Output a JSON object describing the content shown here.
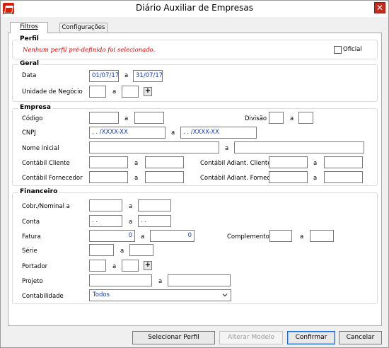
{
  "window": {
    "title": "Diário Auxiliar de Empresas",
    "close_glyph": "✕"
  },
  "tabs": [
    {
      "label": "Filtros",
      "active": true
    },
    {
      "label": "Configurações",
      "active": false
    }
  ],
  "perfil": {
    "title": "Perfil",
    "message": "Nenhum perfil pré-definido foi selecionado.",
    "oficial_label": "Oficial",
    "oficial_checked": false
  },
  "geral": {
    "title": "Geral",
    "data_label": "Data",
    "data_from": "01/07/17",
    "data_to": "31/07/17",
    "a": "a",
    "unidade_label": "Unidade de Negócio",
    "plus": "+"
  },
  "empresa": {
    "title": "Empresa",
    "codigo_label": "Código",
    "divisao_label": "Divisão",
    "cnpj_label": "CNPJ",
    "cnpj_from": "  .   .   /XXXX-XX",
    "cnpj_to": "  .   .   /XXXX-XX",
    "nome_label": "Nome inicial",
    "contabil_cliente_label": "Contábil Cliente",
    "contabil_adiant_cliente_label": "Contábil Adiant. Cliente",
    "contabil_fornecedor_label": "Contábil Fornecedor",
    "contabil_adiant_fornec_label": "Contábil Adiant. Fornec."
  },
  "financeiro": {
    "title": "Financeiro",
    "cobr_label": "Cobr./Nominal a",
    "conta_label": "Conta",
    "conta_from": "  .   .",
    "conta_to": "  .   .",
    "fatura_label": "Fatura",
    "fatura_from": "0",
    "fatura_to": "0",
    "complemento_label": "Complemento",
    "serie_label": "Série",
    "portador_label": "Portador",
    "projeto_label": "Projeto",
    "contabilidade_label": "Contabilidade",
    "contabilidade_value": "Todos"
  },
  "buttons": {
    "selecionar": "Selecionar Perfil",
    "alterar": "Alterar Modelo",
    "confirmar": "Confirmar",
    "cancelar": "Cancelar"
  },
  "colors": {
    "title_bar": "#ffffff",
    "accent_red": "#e00000",
    "field_text": "#1a3aa8",
    "close_red": "#c42b1c"
  }
}
